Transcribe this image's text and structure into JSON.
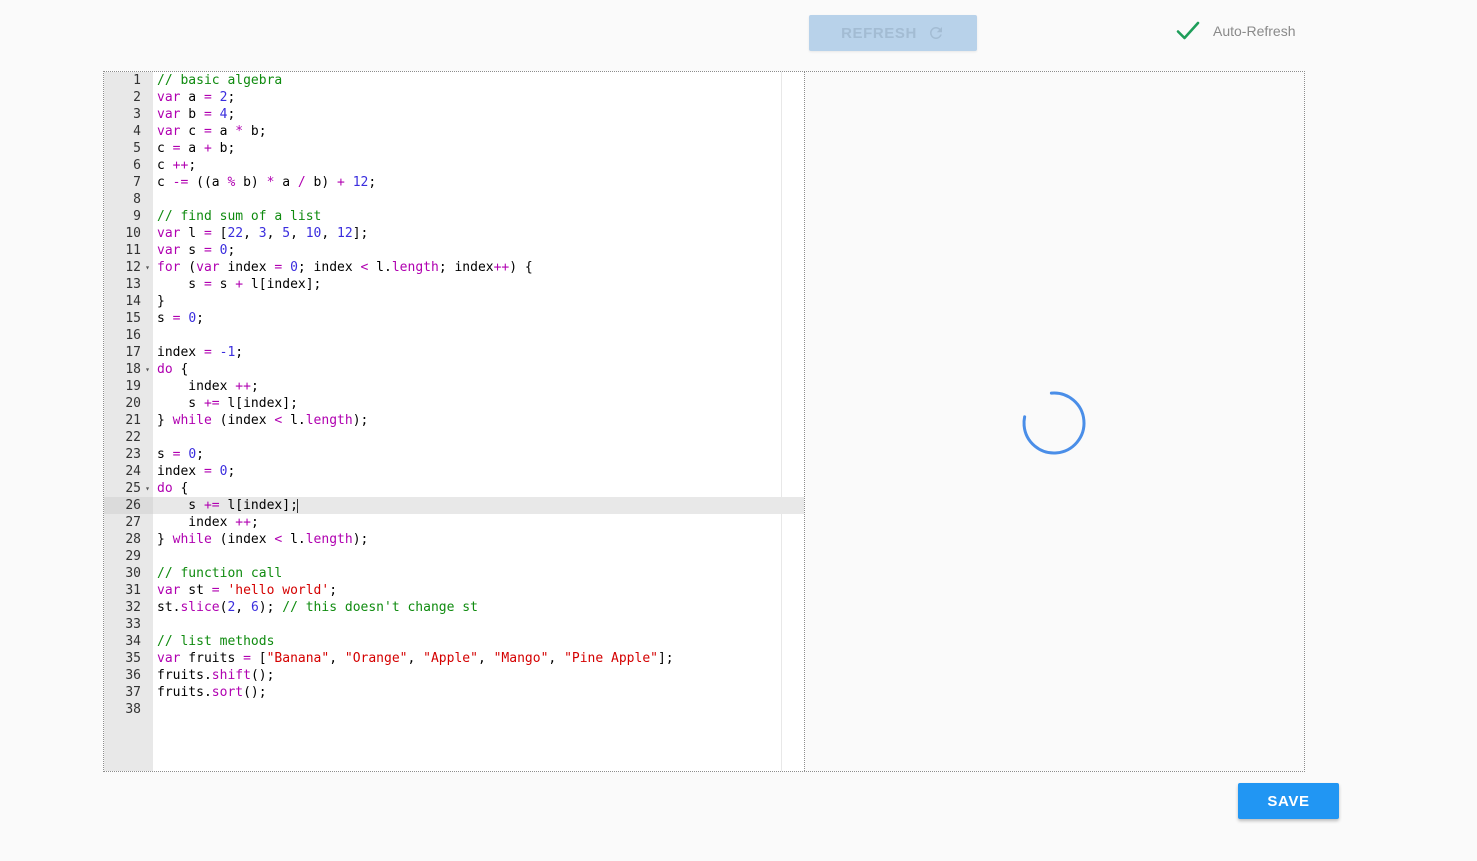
{
  "toolbar": {
    "refresh_label": "REFRESH",
    "refresh_icon": "refresh-icon",
    "auto_refresh_label": "Auto-Refresh",
    "auto_refresh_checked": true,
    "check_icon": "check-icon"
  },
  "editor": {
    "active_line": 26,
    "lines": [
      [
        [
          "c",
          "// basic algebra"
        ]
      ],
      [
        [
          "k",
          "var"
        ],
        [
          "p",
          " a "
        ],
        [
          "o",
          "="
        ],
        [
          "p",
          " "
        ],
        [
          "n",
          "2"
        ],
        [
          "p",
          ";"
        ]
      ],
      [
        [
          "k",
          "var"
        ],
        [
          "p",
          " b "
        ],
        [
          "o",
          "="
        ],
        [
          "p",
          " "
        ],
        [
          "n",
          "4"
        ],
        [
          "p",
          ";"
        ]
      ],
      [
        [
          "k",
          "var"
        ],
        [
          "p",
          " c "
        ],
        [
          "o",
          "="
        ],
        [
          "p",
          " a "
        ],
        [
          "o",
          "*"
        ],
        [
          "p",
          " b;"
        ]
      ],
      [
        [
          "p",
          "c "
        ],
        [
          "o",
          "="
        ],
        [
          "p",
          " a "
        ],
        [
          "o",
          "+"
        ],
        [
          "p",
          " b;"
        ]
      ],
      [
        [
          "p",
          "c "
        ],
        [
          "o",
          "++"
        ],
        [
          "p",
          ";"
        ]
      ],
      [
        [
          "p",
          "c "
        ],
        [
          "o",
          "-="
        ],
        [
          "p",
          " ((a "
        ],
        [
          "o",
          "%"
        ],
        [
          "p",
          " b) "
        ],
        [
          "o",
          "*"
        ],
        [
          "p",
          " a "
        ],
        [
          "o",
          "/"
        ],
        [
          "p",
          " b) "
        ],
        [
          "o",
          "+"
        ],
        [
          "p",
          " "
        ],
        [
          "n",
          "12"
        ],
        [
          "p",
          ";"
        ]
      ],
      [],
      [
        [
          "c",
          "// find sum of a list"
        ]
      ],
      [
        [
          "k",
          "var"
        ],
        [
          "p",
          " l "
        ],
        [
          "o",
          "="
        ],
        [
          "p",
          " ["
        ],
        [
          "n",
          "22"
        ],
        [
          "p",
          ", "
        ],
        [
          "n",
          "3"
        ],
        [
          "p",
          ", "
        ],
        [
          "n",
          "5"
        ],
        [
          "p",
          ", "
        ],
        [
          "n",
          "10"
        ],
        [
          "p",
          ", "
        ],
        [
          "n",
          "12"
        ],
        [
          "p",
          "];"
        ]
      ],
      [
        [
          "k",
          "var"
        ],
        [
          "p",
          " s "
        ],
        [
          "o",
          "="
        ],
        [
          "p",
          " "
        ],
        [
          "n",
          "0"
        ],
        [
          "p",
          ";"
        ]
      ],
      [
        [
          "k",
          "for"
        ],
        [
          "p",
          " ("
        ],
        [
          "k",
          "var"
        ],
        [
          "p",
          " index "
        ],
        [
          "o",
          "="
        ],
        [
          "p",
          " "
        ],
        [
          "n",
          "0"
        ],
        [
          "p",
          "; index "
        ],
        [
          "o",
          "<"
        ],
        [
          "p",
          " l."
        ],
        [
          "f",
          "length"
        ],
        [
          "p",
          "; index"
        ],
        [
          "o",
          "++"
        ],
        [
          "p",
          ") {"
        ]
      ],
      [
        [
          "p",
          "    s "
        ],
        [
          "o",
          "="
        ],
        [
          "p",
          " s "
        ],
        [
          "o",
          "+"
        ],
        [
          "p",
          " l[index];"
        ]
      ],
      [
        [
          "p",
          "}"
        ]
      ],
      [
        [
          "p",
          "s "
        ],
        [
          "o",
          "="
        ],
        [
          "p",
          " "
        ],
        [
          "n",
          "0"
        ],
        [
          "p",
          ";"
        ]
      ],
      [],
      [
        [
          "p",
          "index "
        ],
        [
          "o",
          "="
        ],
        [
          "p",
          " "
        ],
        [
          "n",
          "-1"
        ],
        [
          "p",
          ";"
        ]
      ],
      [
        [
          "k",
          "do"
        ],
        [
          "p",
          " {"
        ]
      ],
      [
        [
          "p",
          "    index "
        ],
        [
          "o",
          "++"
        ],
        [
          "p",
          ";"
        ]
      ],
      [
        [
          "p",
          "    s "
        ],
        [
          "o",
          "+="
        ],
        [
          "p",
          " l[index];"
        ]
      ],
      [
        [
          "p",
          "} "
        ],
        [
          "k",
          "while"
        ],
        [
          "p",
          " (index "
        ],
        [
          "o",
          "<"
        ],
        [
          "p",
          " l."
        ],
        [
          "f",
          "length"
        ],
        [
          "p",
          ");"
        ]
      ],
      [],
      [
        [
          "p",
          "s "
        ],
        [
          "o",
          "="
        ],
        [
          "p",
          " "
        ],
        [
          "n",
          "0"
        ],
        [
          "p",
          ";"
        ]
      ],
      [
        [
          "p",
          "index "
        ],
        [
          "o",
          "="
        ],
        [
          "p",
          " "
        ],
        [
          "n",
          "0"
        ],
        [
          "p",
          ";"
        ]
      ],
      [
        [
          "k",
          "do"
        ],
        [
          "p",
          " {"
        ]
      ],
      [
        [
          "p",
          "    s "
        ],
        [
          "o",
          "+="
        ],
        [
          "p",
          " l[index];"
        ]
      ],
      [
        [
          "p",
          "    index "
        ],
        [
          "o",
          "++"
        ],
        [
          "p",
          ";"
        ]
      ],
      [
        [
          "p",
          "} "
        ],
        [
          "k",
          "while"
        ],
        [
          "p",
          " (index "
        ],
        [
          "o",
          "<"
        ],
        [
          "p",
          " l."
        ],
        [
          "f",
          "length"
        ],
        [
          "p",
          ");"
        ]
      ],
      [],
      [
        [
          "c",
          "// function call"
        ]
      ],
      [
        [
          "k",
          "var"
        ],
        [
          "p",
          " st "
        ],
        [
          "o",
          "="
        ],
        [
          "p",
          " "
        ],
        [
          "s",
          "'hello world'"
        ],
        [
          "p",
          ";"
        ]
      ],
      [
        [
          "p",
          "st."
        ],
        [
          "f",
          "slice"
        ],
        [
          "p",
          "("
        ],
        [
          "n",
          "2"
        ],
        [
          "p",
          ", "
        ],
        [
          "n",
          "6"
        ],
        [
          "p",
          "); "
        ],
        [
          "c",
          "// this doesn't change st"
        ]
      ],
      [],
      [
        [
          "c",
          "// list methods"
        ]
      ],
      [
        [
          "k",
          "var"
        ],
        [
          "p",
          " fruits "
        ],
        [
          "o",
          "="
        ],
        [
          "p",
          " ["
        ],
        [
          "s",
          "\"Banana\""
        ],
        [
          "p",
          ", "
        ],
        [
          "s",
          "\"Orange\""
        ],
        [
          "p",
          ", "
        ],
        [
          "s",
          "\"Apple\""
        ],
        [
          "p",
          ", "
        ],
        [
          "s",
          "\"Mango\""
        ],
        [
          "p",
          ", "
        ],
        [
          "s",
          "\"Pine Apple\""
        ],
        [
          "p",
          "];"
        ]
      ],
      [
        [
          "p",
          "fruits."
        ],
        [
          "f",
          "shift"
        ],
        [
          "p",
          "();"
        ]
      ],
      [
        [
          "p",
          "fruits."
        ],
        [
          "f",
          "sort"
        ],
        [
          "p",
          "();"
        ]
      ],
      []
    ],
    "fold_lines": [
      12,
      18,
      25
    ],
    "token_colors": {
      "c": "#0f8b0f",
      "k": "#b000b0",
      "n": "#3a2dde",
      "o": "#b000b0",
      "s": "#d40000",
      "f": "#b000b0",
      "p": "#000000"
    }
  },
  "preview": {
    "loading": true,
    "spinner_icon": "loading-spinner-icon",
    "spinner_color": "#4a8ee8"
  },
  "footer": {
    "save_label": "SAVE"
  }
}
